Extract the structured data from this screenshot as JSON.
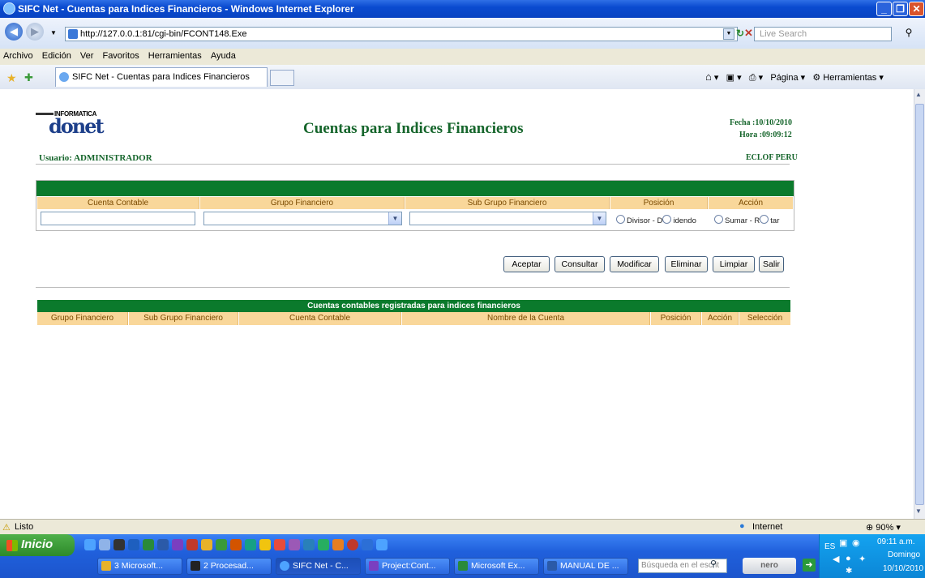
{
  "window": {
    "title": "SIFC Net - Cuentas para Indices Financieros - Windows Internet Explorer"
  },
  "browser": {
    "address": "http://127.0.0.1:81/cgi-bin/FCONT148.Exe",
    "search_placeholder": "Live Search",
    "menu": [
      "Archivo",
      "Edición",
      "Ver",
      "Favoritos",
      "Herramientas",
      "Ayuda"
    ],
    "tab_label": "SIFC Net - Cuentas para Indices Financieros",
    "tools": {
      "page": "Página",
      "tools": "Herramientas"
    }
  },
  "page": {
    "logo_top": "INFORMATICA",
    "logo_main": "donet",
    "user_label": "Usuario:",
    "user_name": "ADMINISTRADOR",
    "title": "Cuentas para Indices Financieros",
    "fecha_label": "Fecha :",
    "fecha": "10/10/2010",
    "hora_label": "Hora :",
    "hora": "09:09:12",
    "org": "ECLOF PERU",
    "form_headers": [
      "Cuenta Contable",
      "Grupo Financiero",
      "Sub Grupo Financiero",
      "Posición",
      "Acción"
    ],
    "posicion_options": [
      "Divisor",
      "Dividendo"
    ],
    "posicion_text": "Divisor - D",
    "posicion_text2": "idendo",
    "accion_text": "Sumar - R",
    "accion_text2": "tar",
    "buttons": [
      "Aceptar",
      "Consultar",
      "Modificar",
      "Eliminar",
      "Limpiar",
      "Salir"
    ],
    "list_title": "Cuentas contables registradas para indices financieros",
    "list_headers": [
      "Grupo Financiero",
      "Sub Grupo Financiero",
      "Cuenta Contable",
      "Nombre de la Cuenta",
      "Posición",
      "Acción",
      "Selección"
    ]
  },
  "statusbar": {
    "status": "Listo",
    "zone": "Internet",
    "zoom": "90%"
  },
  "taskbar": {
    "start": "Inicio",
    "buttons": [
      "3 Microsoft...",
      "2 Procesad...",
      "SIFC Net - C...",
      "Project:Cont...",
      "Microsoft Ex...",
      "MANUAL DE ..."
    ],
    "search_placeholder": "Búsqueda en el escrit",
    "lang": "ES",
    "time": "09:11 a.m.",
    "day": "Domingo",
    "date": "10/10/2010",
    "nero": "nero"
  }
}
